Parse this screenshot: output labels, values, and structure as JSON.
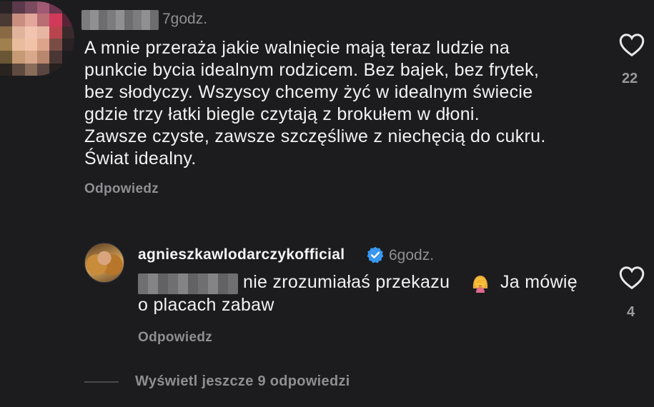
{
  "comment": {
    "username_blurred": true,
    "time": "7godz.",
    "text": "A mnie przeraża jakie walnięcie mają teraz ludzie na\npunkcie bycia idealnym rodzicem. Bez bajek, bez frytek,\nbez słodyczy. Wszyscy chcemy żyć w idealnym świecie\ngdzie trzy łatki biegle czytają z brokułem w dłoni.\nZawsze czyste, zawsze szczęśliwe z niechęcią do cukru.\nŚwiat idealny.",
    "reply_label": "Odpowiedz",
    "like_count": "22",
    "like_icon": "heart-outline-icon"
  },
  "reply": {
    "username": "agnieszkawlodarczykofficial",
    "verified_icon": "verified-badge-icon",
    "time": "6godz.",
    "mention_blurred": true,
    "text_part1": "nie zrozumiałaś przekazu",
    "emoji": "woman-facepalming",
    "text_part2": "Ja mówię",
    "text_line2": "o placach zabaw",
    "reply_label": "Odpowiedz",
    "like_count": "4",
    "like_icon": "heart-outline-icon"
  },
  "view_more": {
    "label": "Wyświetl jeszcze 9 odpowiedzi"
  },
  "colors": {
    "background": "#1c1c1e",
    "text": "#f2f2f2",
    "secondary": "#8e8e93",
    "verified": "#3897f0"
  }
}
